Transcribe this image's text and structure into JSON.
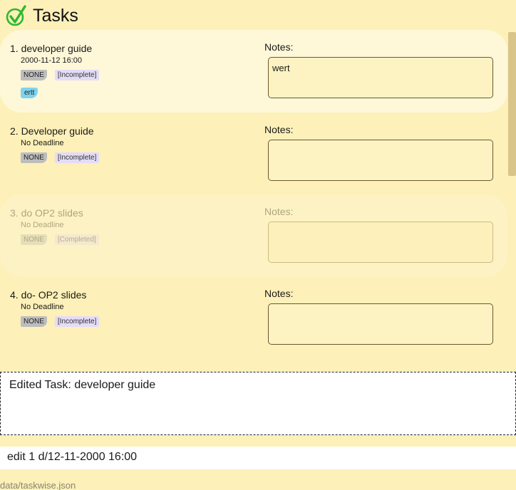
{
  "app": {
    "title": "Tasks",
    "logo_icon": "check-circle-icon",
    "accent": "#2fb82f"
  },
  "tasks": [
    {
      "name": "1. developer guide",
      "deadline": "2000-11-12 16:00",
      "priority": "NONE",
      "status": "[Incomplete]",
      "tag": "ertt",
      "notes_label": "Notes:",
      "notes": "wert"
    },
    {
      "name": "2. Developer guide",
      "deadline": "No Deadline",
      "priority": "NONE",
      "status": "[Incomplete]",
      "notes_label": "Notes:",
      "notes": ""
    },
    {
      "name": "3. do OP2 slides",
      "deadline": "No Deadline",
      "priority": "NONE",
      "status": "[Completed]",
      "notes_label": "Notes:",
      "notes": ""
    },
    {
      "name": "4. do- OP2 slides",
      "deadline": "No Deadline",
      "priority": "NONE",
      "status": "[Incomplete]",
      "notes_label": "Notes:",
      "notes": ""
    }
  ],
  "result": {
    "text": "Edited Task: developer guide"
  },
  "command": {
    "value": "edit 1 d/12-11-2000 16:00"
  },
  "statusbar": {
    "path": "data/taskwise.json"
  }
}
